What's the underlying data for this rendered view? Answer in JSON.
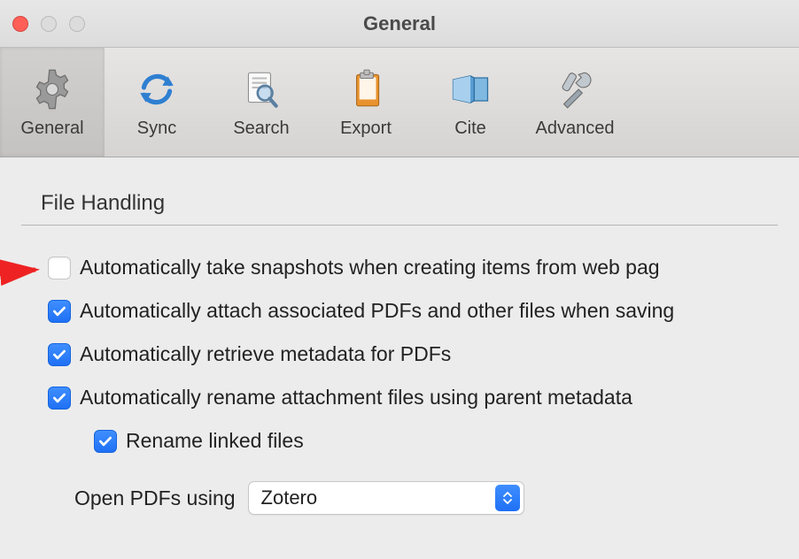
{
  "window": {
    "title": "General"
  },
  "toolbar": {
    "items": [
      {
        "label": "General",
        "icon": "gear-icon",
        "selected": true
      },
      {
        "label": "Sync",
        "icon": "sync-icon",
        "selected": false
      },
      {
        "label": "Search",
        "icon": "search-icon",
        "selected": false
      },
      {
        "label": "Export",
        "icon": "export-icon",
        "selected": false
      },
      {
        "label": "Cite",
        "icon": "cite-icon",
        "selected": false
      },
      {
        "label": "Advanced",
        "icon": "advanced-icon",
        "selected": false
      }
    ]
  },
  "section": {
    "title": "File Handling"
  },
  "options": {
    "snapshots": {
      "label": "Automatically take snapshots when creating items from web pag",
      "checked": false
    },
    "attach_pdfs": {
      "label": "Automatically attach associated PDFs and other files when saving",
      "checked": true
    },
    "retrieve_metadata": {
      "label": "Automatically retrieve metadata for PDFs",
      "checked": true
    },
    "rename_attachments": {
      "label": "Automatically rename attachment files using parent metadata",
      "checked": true
    },
    "rename_linked": {
      "label": "Rename linked files",
      "checked": true
    }
  },
  "open_pdfs": {
    "label": "Open PDFs using",
    "value": "Zotero"
  }
}
